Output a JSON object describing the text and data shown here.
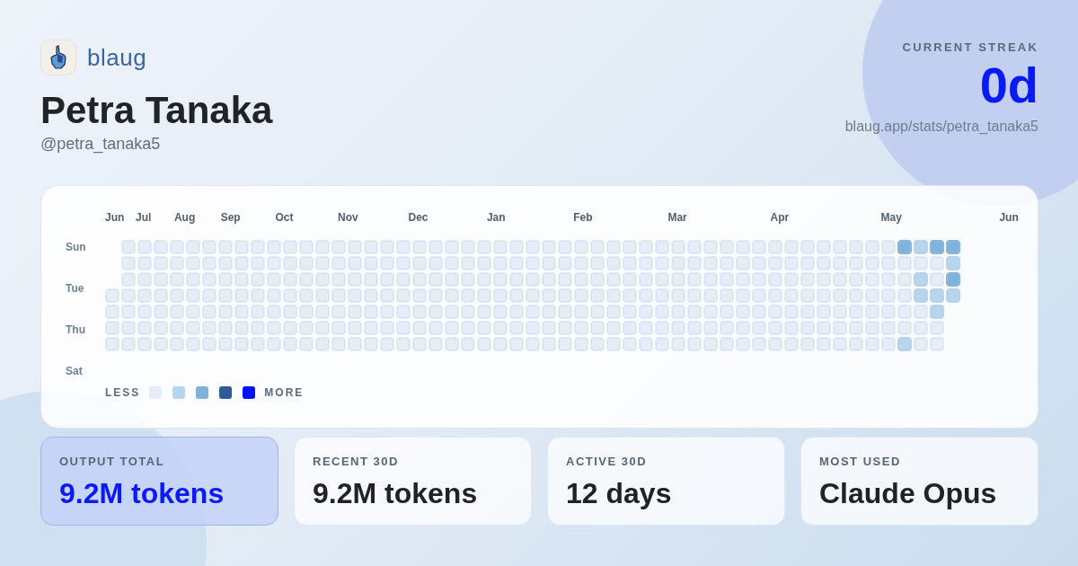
{
  "brand": {
    "name": "blaug"
  },
  "profile": {
    "name": "Petra Tanaka",
    "handle": "@petra_tanaka5"
  },
  "streak": {
    "label": "CURRENT STREAK",
    "value": "0d",
    "url": "blaug.app/stats/petra_tanaka5"
  },
  "heatmap": {
    "months": [
      "Jun",
      "Jul",
      "Aug",
      "Sep",
      "Oct",
      "Nov",
      "Dec",
      "Jan",
      "Feb",
      "Mar",
      "Apr",
      "May",
      "Jun"
    ],
    "day_labels": [
      "Sun",
      "Tue",
      "Thu",
      "Sat"
    ],
    "weeks": [
      {
        "kind": "first",
        "days": [
          {
            "color": "#e6edf7"
          },
          {
            "color": "#e6edf7"
          },
          {
            "color": "#e6edf7"
          },
          {
            "color": "#e6edf7"
          }
        ]
      },
      {
        "kind": "full",
        "days": [
          {
            "color": "#e6edf7"
          },
          {
            "color": "#e6edf7"
          },
          {
            "color": "#e6edf7"
          },
          {
            "color": "#e6edf7"
          },
          {
            "color": "#e6edf7"
          },
          {
            "color": "#e6edf7"
          },
          {
            "color": "#e6edf7"
          }
        ]
      },
      {
        "kind": "full",
        "days": [
          {
            "color": "#e6edf7"
          },
          {
            "color": "#e6edf7"
          },
          {
            "color": "#e6edf7"
          },
          {
            "color": "#e6edf7"
          },
          {
            "color": "#e6edf7"
          },
          {
            "color": "#e6edf7"
          },
          {
            "color": "#e6edf7"
          }
        ]
      },
      {
        "kind": "full",
        "days": [
          {
            "color": "#e6edf7"
          },
          {
            "color": "#e6edf7"
          },
          {
            "color": "#e6edf7"
          },
          {
            "color": "#e6edf7"
          },
          {
            "color": "#e6edf7"
          },
          {
            "color": "#e6edf7"
          },
          {
            "color": "#e6edf7"
          }
        ]
      },
      {
        "kind": "full",
        "days": [
          {
            "color": "#e6edf7"
          },
          {
            "color": "#e6edf7"
          },
          {
            "color": "#e6edf7"
          },
          {
            "color": "#e6edf7"
          },
          {
            "color": "#e6edf7"
          },
          {
            "color": "#e6edf7"
          },
          {
            "color": "#e6edf7"
          }
        ]
      },
      {
        "kind": "full",
        "days": [
          {
            "color": "#e6edf7"
          },
          {
            "color": "#e6edf7"
          },
          {
            "color": "#e6edf7"
          },
          {
            "color": "#e6edf7"
          },
          {
            "color": "#e6edf7"
          },
          {
            "color": "#e6edf7"
          },
          {
            "color": "#e6edf7"
          }
        ]
      },
      {
        "kind": "full",
        "days": [
          {
            "color": "#e6edf7"
          },
          {
            "color": "#e6edf7"
          },
          {
            "color": "#e6edf7"
          },
          {
            "color": "#e6edf7"
          },
          {
            "color": "#e6edf7"
          },
          {
            "color": "#e6edf7"
          },
          {
            "color": "#e6edf7"
          }
        ]
      },
      {
        "kind": "full",
        "days": [
          {
            "color": "#e6edf7"
          },
          {
            "color": "#e6edf7"
          },
          {
            "color": "#e6edf7"
          },
          {
            "color": "#e6edf7"
          },
          {
            "color": "#e6edf7"
          },
          {
            "color": "#e6edf7"
          },
          {
            "color": "#e6edf7"
          }
        ]
      },
      {
        "kind": "full",
        "days": [
          {
            "color": "#e6edf7"
          },
          {
            "color": "#e6edf7"
          },
          {
            "color": "#e6edf7"
          },
          {
            "color": "#e6edf7"
          },
          {
            "color": "#e6edf7"
          },
          {
            "color": "#e6edf7"
          },
          {
            "color": "#e6edf7"
          }
        ]
      },
      {
        "kind": "full",
        "days": [
          {
            "color": "#e6edf7"
          },
          {
            "color": "#e6edf7"
          },
          {
            "color": "#e6edf7"
          },
          {
            "color": "#e6edf7"
          },
          {
            "color": "#e6edf7"
          },
          {
            "color": "#e6edf7"
          },
          {
            "color": "#e6edf7"
          }
        ]
      },
      {
        "kind": "full",
        "days": [
          {
            "color": "#e6edf7"
          },
          {
            "color": "#e6edf7"
          },
          {
            "color": "#e6edf7"
          },
          {
            "color": "#e6edf7"
          },
          {
            "color": "#e6edf7"
          },
          {
            "color": "#e6edf7"
          },
          {
            "color": "#e6edf7"
          }
        ]
      },
      {
        "kind": "full",
        "days": [
          {
            "color": "#e6edf7"
          },
          {
            "color": "#e6edf7"
          },
          {
            "color": "#e6edf7"
          },
          {
            "color": "#e6edf7"
          },
          {
            "color": "#e6edf7"
          },
          {
            "color": "#e6edf7"
          },
          {
            "color": "#e6edf7"
          }
        ]
      },
      {
        "kind": "full",
        "days": [
          {
            "color": "#e6edf7"
          },
          {
            "color": "#e6edf7"
          },
          {
            "color": "#e6edf7"
          },
          {
            "color": "#e6edf7"
          },
          {
            "color": "#e6edf7"
          },
          {
            "color": "#e6edf7"
          },
          {
            "color": "#e6edf7"
          }
        ]
      },
      {
        "kind": "full",
        "days": [
          {
            "color": "#e6edf7"
          },
          {
            "color": "#e6edf7"
          },
          {
            "color": "#e6edf7"
          },
          {
            "color": "#e6edf7"
          },
          {
            "color": "#e6edf7"
          },
          {
            "color": "#e6edf7"
          },
          {
            "color": "#e6edf7"
          }
        ]
      },
      {
        "kind": "full",
        "days": [
          {
            "color": "#e6edf7"
          },
          {
            "color": "#e6edf7"
          },
          {
            "color": "#e6edf7"
          },
          {
            "color": "#e6edf7"
          },
          {
            "color": "#e6edf7"
          },
          {
            "color": "#e6edf7"
          },
          {
            "color": "#e6edf7"
          }
        ]
      },
      {
        "kind": "full",
        "days": [
          {
            "color": "#e6edf7"
          },
          {
            "color": "#e6edf7"
          },
          {
            "color": "#e6edf7"
          },
          {
            "color": "#e6edf7"
          },
          {
            "color": "#e6edf7"
          },
          {
            "color": "#e6edf7"
          },
          {
            "color": "#e6edf7"
          }
        ]
      },
      {
        "kind": "full",
        "days": [
          {
            "color": "#e6edf7"
          },
          {
            "color": "#e6edf7"
          },
          {
            "color": "#e6edf7"
          },
          {
            "color": "#e6edf7"
          },
          {
            "color": "#e6edf7"
          },
          {
            "color": "#e6edf7"
          },
          {
            "color": "#e6edf7"
          }
        ]
      },
      {
        "kind": "full",
        "days": [
          {
            "color": "#e6edf7"
          },
          {
            "color": "#e6edf7"
          },
          {
            "color": "#e6edf7"
          },
          {
            "color": "#e6edf7"
          },
          {
            "color": "#e6edf7"
          },
          {
            "color": "#e6edf7"
          },
          {
            "color": "#e6edf7"
          }
        ]
      },
      {
        "kind": "full",
        "days": [
          {
            "color": "#e6edf7"
          },
          {
            "color": "#e6edf7"
          },
          {
            "color": "#e6edf7"
          },
          {
            "color": "#e6edf7"
          },
          {
            "color": "#e6edf7"
          },
          {
            "color": "#e6edf7"
          },
          {
            "color": "#e6edf7"
          }
        ]
      },
      {
        "kind": "full",
        "days": [
          {
            "color": "#e6edf7"
          },
          {
            "color": "#e6edf7"
          },
          {
            "color": "#e6edf7"
          },
          {
            "color": "#e6edf7"
          },
          {
            "color": "#e6edf7"
          },
          {
            "color": "#e6edf7"
          },
          {
            "color": "#e6edf7"
          }
        ]
      },
      {
        "kind": "full",
        "days": [
          {
            "color": "#e6edf7"
          },
          {
            "color": "#e6edf7"
          },
          {
            "color": "#e6edf7"
          },
          {
            "color": "#e6edf7"
          },
          {
            "color": "#e6edf7"
          },
          {
            "color": "#e6edf7"
          },
          {
            "color": "#e6edf7"
          }
        ]
      },
      {
        "kind": "full",
        "days": [
          {
            "color": "#e6edf7"
          },
          {
            "color": "#e6edf7"
          },
          {
            "color": "#e6edf7"
          },
          {
            "color": "#e6edf7"
          },
          {
            "color": "#e6edf7"
          },
          {
            "color": "#e6edf7"
          },
          {
            "color": "#e6edf7"
          }
        ]
      },
      {
        "kind": "full",
        "days": [
          {
            "color": "#e6edf7"
          },
          {
            "color": "#e6edf7"
          },
          {
            "color": "#e6edf7"
          },
          {
            "color": "#e6edf7"
          },
          {
            "color": "#e6edf7"
          },
          {
            "color": "#e6edf7"
          },
          {
            "color": "#e6edf7"
          }
        ]
      },
      {
        "kind": "full",
        "days": [
          {
            "color": "#e6edf7"
          },
          {
            "color": "#e6edf7"
          },
          {
            "color": "#e6edf7"
          },
          {
            "color": "#e6edf7"
          },
          {
            "color": "#e6edf7"
          },
          {
            "color": "#e6edf7"
          },
          {
            "color": "#e6edf7"
          }
        ]
      },
      {
        "kind": "full",
        "days": [
          {
            "color": "#e6edf7"
          },
          {
            "color": "#e6edf7"
          },
          {
            "color": "#e6edf7"
          },
          {
            "color": "#e6edf7"
          },
          {
            "color": "#e6edf7"
          },
          {
            "color": "#e6edf7"
          },
          {
            "color": "#e6edf7"
          }
        ]
      },
      {
        "kind": "full",
        "days": [
          {
            "color": "#e6edf7"
          },
          {
            "color": "#e6edf7"
          },
          {
            "color": "#e6edf7"
          },
          {
            "color": "#e6edf7"
          },
          {
            "color": "#e6edf7"
          },
          {
            "color": "#e6edf7"
          },
          {
            "color": "#e6edf7"
          }
        ]
      },
      {
        "kind": "full",
        "days": [
          {
            "color": "#e6edf7"
          },
          {
            "color": "#e6edf7"
          },
          {
            "color": "#e6edf7"
          },
          {
            "color": "#e6edf7"
          },
          {
            "color": "#e6edf7"
          },
          {
            "color": "#e6edf7"
          },
          {
            "color": "#e6edf7"
          }
        ]
      },
      {
        "kind": "full",
        "days": [
          {
            "color": "#e6edf7"
          },
          {
            "color": "#e6edf7"
          },
          {
            "color": "#e6edf7"
          },
          {
            "color": "#e6edf7"
          },
          {
            "color": "#e6edf7"
          },
          {
            "color": "#e6edf7"
          },
          {
            "color": "#e6edf7"
          }
        ]
      },
      {
        "kind": "full",
        "days": [
          {
            "color": "#e6edf7"
          },
          {
            "color": "#e6edf7"
          },
          {
            "color": "#e6edf7"
          },
          {
            "color": "#e6edf7"
          },
          {
            "color": "#e6edf7"
          },
          {
            "color": "#e6edf7"
          },
          {
            "color": "#e6edf7"
          }
        ]
      },
      {
        "kind": "full",
        "days": [
          {
            "color": "#e6edf7"
          },
          {
            "color": "#e6edf7"
          },
          {
            "color": "#e6edf7"
          },
          {
            "color": "#e6edf7"
          },
          {
            "color": "#e6edf7"
          },
          {
            "color": "#e6edf7"
          },
          {
            "color": "#e6edf7"
          }
        ]
      },
      {
        "kind": "full",
        "days": [
          {
            "color": "#e6edf7"
          },
          {
            "color": "#e6edf7"
          },
          {
            "color": "#e6edf7"
          },
          {
            "color": "#e6edf7"
          },
          {
            "color": "#e6edf7"
          },
          {
            "color": "#e6edf7"
          },
          {
            "color": "#e6edf7"
          }
        ]
      },
      {
        "kind": "full",
        "days": [
          {
            "color": "#e6edf7"
          },
          {
            "color": "#e6edf7"
          },
          {
            "color": "#e6edf7"
          },
          {
            "color": "#e6edf7"
          },
          {
            "color": "#e6edf7"
          },
          {
            "color": "#e6edf7"
          },
          {
            "color": "#e6edf7"
          }
        ]
      },
      {
        "kind": "full",
        "days": [
          {
            "color": "#e6edf7"
          },
          {
            "color": "#e6edf7"
          },
          {
            "color": "#e6edf7"
          },
          {
            "color": "#e6edf7"
          },
          {
            "color": "#e6edf7"
          },
          {
            "color": "#e6edf7"
          },
          {
            "color": "#e6edf7"
          }
        ]
      },
      {
        "kind": "full",
        "days": [
          {
            "color": "#e6edf7"
          },
          {
            "color": "#e6edf7"
          },
          {
            "color": "#e6edf7"
          },
          {
            "color": "#e6edf7"
          },
          {
            "color": "#e6edf7"
          },
          {
            "color": "#e6edf7"
          },
          {
            "color": "#e6edf7"
          }
        ]
      },
      {
        "kind": "full",
        "days": [
          {
            "color": "#e6edf7"
          },
          {
            "color": "#e6edf7"
          },
          {
            "color": "#e6edf7"
          },
          {
            "color": "#e6edf7"
          },
          {
            "color": "#e6edf7"
          },
          {
            "color": "#e6edf7"
          },
          {
            "color": "#e6edf7"
          }
        ]
      },
      {
        "kind": "full",
        "days": [
          {
            "color": "#e6edf7"
          },
          {
            "color": "#e6edf7"
          },
          {
            "color": "#e6edf7"
          },
          {
            "color": "#e6edf7"
          },
          {
            "color": "#e6edf7"
          },
          {
            "color": "#e6edf7"
          },
          {
            "color": "#e6edf7"
          }
        ]
      },
      {
        "kind": "full",
        "days": [
          {
            "color": "#e6edf7"
          },
          {
            "color": "#e6edf7"
          },
          {
            "color": "#e6edf7"
          },
          {
            "color": "#e6edf7"
          },
          {
            "color": "#e6edf7"
          },
          {
            "color": "#e6edf7"
          },
          {
            "color": "#e6edf7"
          }
        ]
      },
      {
        "kind": "full",
        "days": [
          {
            "color": "#e6edf7"
          },
          {
            "color": "#e6edf7"
          },
          {
            "color": "#e6edf7"
          },
          {
            "color": "#e6edf7"
          },
          {
            "color": "#e6edf7"
          },
          {
            "color": "#e6edf7"
          },
          {
            "color": "#e6edf7"
          }
        ]
      },
      {
        "kind": "full",
        "days": [
          {
            "color": "#e6edf7"
          },
          {
            "color": "#e6edf7"
          },
          {
            "color": "#e6edf7"
          },
          {
            "color": "#e6edf7"
          },
          {
            "color": "#e6edf7"
          },
          {
            "color": "#e6edf7"
          },
          {
            "color": "#e6edf7"
          }
        ]
      },
      {
        "kind": "full",
        "days": [
          {
            "color": "#e6edf7"
          },
          {
            "color": "#e6edf7"
          },
          {
            "color": "#e6edf7"
          },
          {
            "color": "#e6edf7"
          },
          {
            "color": "#e6edf7"
          },
          {
            "color": "#e6edf7"
          },
          {
            "color": "#e6edf7"
          }
        ]
      },
      {
        "kind": "full",
        "days": [
          {
            "color": "#e6edf7"
          },
          {
            "color": "#e6edf7"
          },
          {
            "color": "#e6edf7"
          },
          {
            "color": "#e6edf7"
          },
          {
            "color": "#e6edf7"
          },
          {
            "color": "#e6edf7"
          },
          {
            "color": "#e6edf7"
          }
        ]
      },
      {
        "kind": "full",
        "days": [
          {
            "color": "#e6edf7"
          },
          {
            "color": "#e6edf7"
          },
          {
            "color": "#e6edf7"
          },
          {
            "color": "#e6edf7"
          },
          {
            "color": "#e6edf7"
          },
          {
            "color": "#e6edf7"
          },
          {
            "color": "#e6edf7"
          }
        ]
      },
      {
        "kind": "full",
        "days": [
          {
            "color": "#e6edf7"
          },
          {
            "color": "#e6edf7"
          },
          {
            "color": "#e6edf7"
          },
          {
            "color": "#e6edf7"
          },
          {
            "color": "#e6edf7"
          },
          {
            "color": "#e6edf7"
          },
          {
            "color": "#e6edf7"
          }
        ]
      },
      {
        "kind": "full",
        "days": [
          {
            "color": "#e6edf7"
          },
          {
            "color": "#e6edf7"
          },
          {
            "color": "#e6edf7"
          },
          {
            "color": "#e6edf7"
          },
          {
            "color": "#e6edf7"
          },
          {
            "color": "#e6edf7"
          },
          {
            "color": "#e6edf7"
          }
        ]
      },
      {
        "kind": "full",
        "days": [
          {
            "color": "#e6edf7"
          },
          {
            "color": "#e6edf7"
          },
          {
            "color": "#e6edf7"
          },
          {
            "color": "#e6edf7"
          },
          {
            "color": "#e6edf7"
          },
          {
            "color": "#e6edf7"
          },
          {
            "color": "#e6edf7"
          }
        ]
      },
      {
        "kind": "full",
        "days": [
          {
            "color": "#e6edf7"
          },
          {
            "color": "#e6edf7"
          },
          {
            "color": "#e6edf7"
          },
          {
            "color": "#e6edf7"
          },
          {
            "color": "#e6edf7"
          },
          {
            "color": "#e6edf7"
          },
          {
            "color": "#e6edf7"
          }
        ]
      },
      {
        "kind": "full",
        "days": [
          {
            "color": "#e6edf7"
          },
          {
            "color": "#e6edf7"
          },
          {
            "color": "#e6edf7"
          },
          {
            "color": "#e6edf7"
          },
          {
            "color": "#e6edf7"
          },
          {
            "color": "#e6edf7"
          },
          {
            "color": "#e6edf7"
          }
        ]
      },
      {
        "kind": "full",
        "days": [
          {
            "color": "#e6edf7"
          },
          {
            "color": "#e6edf7"
          },
          {
            "color": "#e6edf7"
          },
          {
            "color": "#e6edf7"
          },
          {
            "color": "#e6edf7"
          },
          {
            "color": "#e6edf7"
          },
          {
            "color": "#e6edf7"
          }
        ]
      },
      {
        "kind": "full",
        "days": [
          {
            "color": "#e6edf7"
          },
          {
            "color": "#e6edf7"
          },
          {
            "color": "#e6edf7"
          },
          {
            "color": "#e6edf7"
          },
          {
            "color": "#e6edf7"
          },
          {
            "color": "#e6edf7"
          },
          {
            "color": "#e6edf7"
          }
        ]
      },
      {
        "kind": "full",
        "days": [
          {
            "color": "#7fb2dc"
          },
          {
            "color": "#e6edf7"
          },
          {
            "color": "#e6edf7"
          },
          {
            "color": "#e6edf7"
          },
          {
            "color": "#e6edf7"
          },
          {
            "color": "#e6edf7"
          },
          {
            "color": "#b7d5ec"
          }
        ]
      },
      {
        "kind": "full",
        "days": [
          {
            "color": "#b7d5ec"
          },
          {
            "color": "#e6edf7"
          },
          {
            "color": "#b7d5ec"
          },
          {
            "color": "#b7d5ec"
          },
          {
            "color": "#e6edf7"
          },
          {
            "color": "#e6edf7"
          },
          {
            "color": "#e6edf7"
          }
        ]
      },
      {
        "kind": "full",
        "days": [
          {
            "color": "#7fb2dc"
          },
          {
            "color": "#e6edf7"
          },
          {
            "color": "#e6edf7"
          },
          {
            "color": "#b7d5ec"
          },
          {
            "color": "#b7d5ec"
          },
          {
            "color": "#e6edf7"
          },
          {
            "color": "#e6edf7"
          }
        ]
      },
      {
        "kind": "last",
        "days": [
          {
            "color": "#7fb2dc"
          },
          {
            "color": "#b7d5ec"
          },
          {
            "color": "#7fb2dc"
          },
          {
            "color": "#b7d5ec"
          }
        ]
      }
    ],
    "legend": {
      "less": "LESS",
      "more": "MORE",
      "swatches": [
        {
          "color": "#e6edf7"
        },
        {
          "color": "#b7d5ec"
        },
        {
          "color": "#7fb2dc"
        },
        {
          "color": "#2f5a9a"
        },
        {
          "color": "#0011ff"
        }
      ]
    }
  },
  "stats": [
    {
      "label": "OUTPUT TOTAL",
      "value": "9.2M tokens",
      "highlighted": true
    },
    {
      "label": "RECENT 30D",
      "value": "9.2M tokens",
      "highlighted": false
    },
    {
      "label": "ACTIVE 30D",
      "value": "12 days",
      "highlighted": false
    },
    {
      "label": "MOST USED",
      "value": "Claude Opus",
      "highlighted": false
    }
  ]
}
